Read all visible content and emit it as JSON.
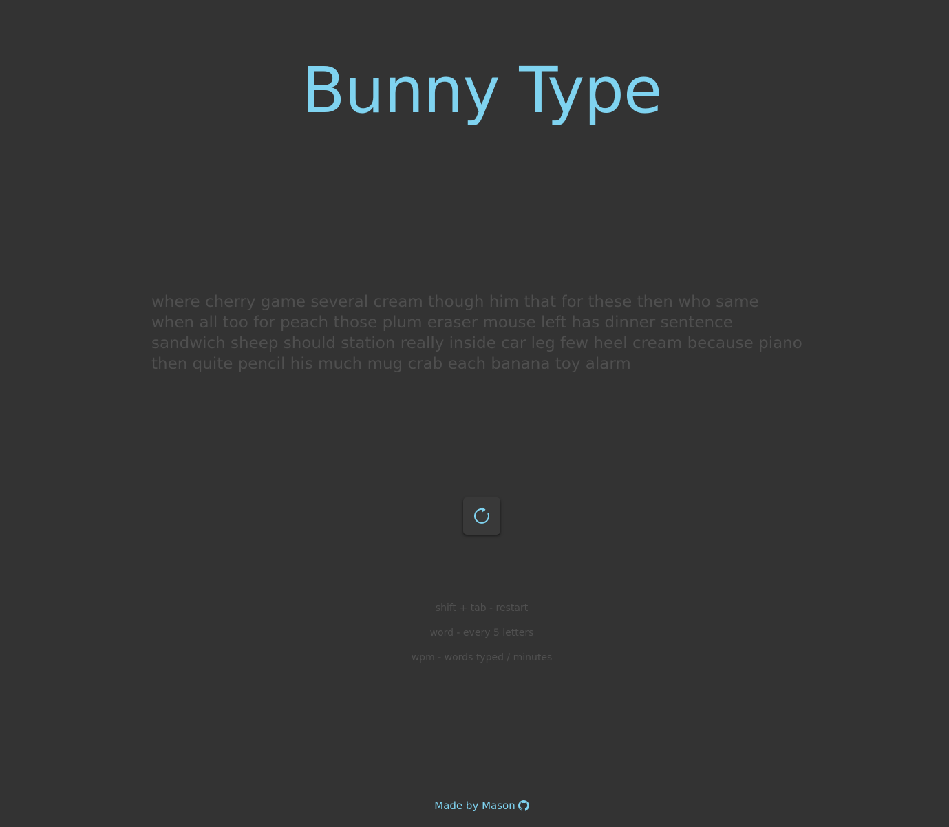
{
  "app": {
    "title": "Bunny Type"
  },
  "typing": {
    "words": [
      "where",
      "cherry",
      "game",
      "several",
      "cream",
      "though",
      "him",
      "that",
      "for",
      "these",
      "then",
      "who",
      "same",
      "when",
      "all",
      "too",
      "for",
      "peach",
      "those",
      "plum",
      "eraser",
      "mouse",
      "left",
      "has",
      "dinner",
      "sentence",
      "sandwich",
      "sheep",
      "should",
      "station",
      "really",
      "inside",
      "car",
      "leg",
      "few",
      "heel",
      "cream",
      "because",
      "piano",
      "then",
      "quite",
      "pencil",
      "his",
      "much",
      "mug",
      "crab",
      "each",
      "banana",
      "toy",
      "alarm"
    ]
  },
  "controls": {
    "restart_icon": "restart-icon"
  },
  "hints": [
    "shift + tab - restart",
    "word - every 5 letters",
    "wpm - words typed / minutes"
  ],
  "footer": {
    "text": "Made by Mason",
    "icon": "github-icon"
  },
  "colors": {
    "accent": "#7fd3f0",
    "background": "#333333",
    "untyped_text": "#4f4f4f",
    "hint_text": "#505050"
  }
}
